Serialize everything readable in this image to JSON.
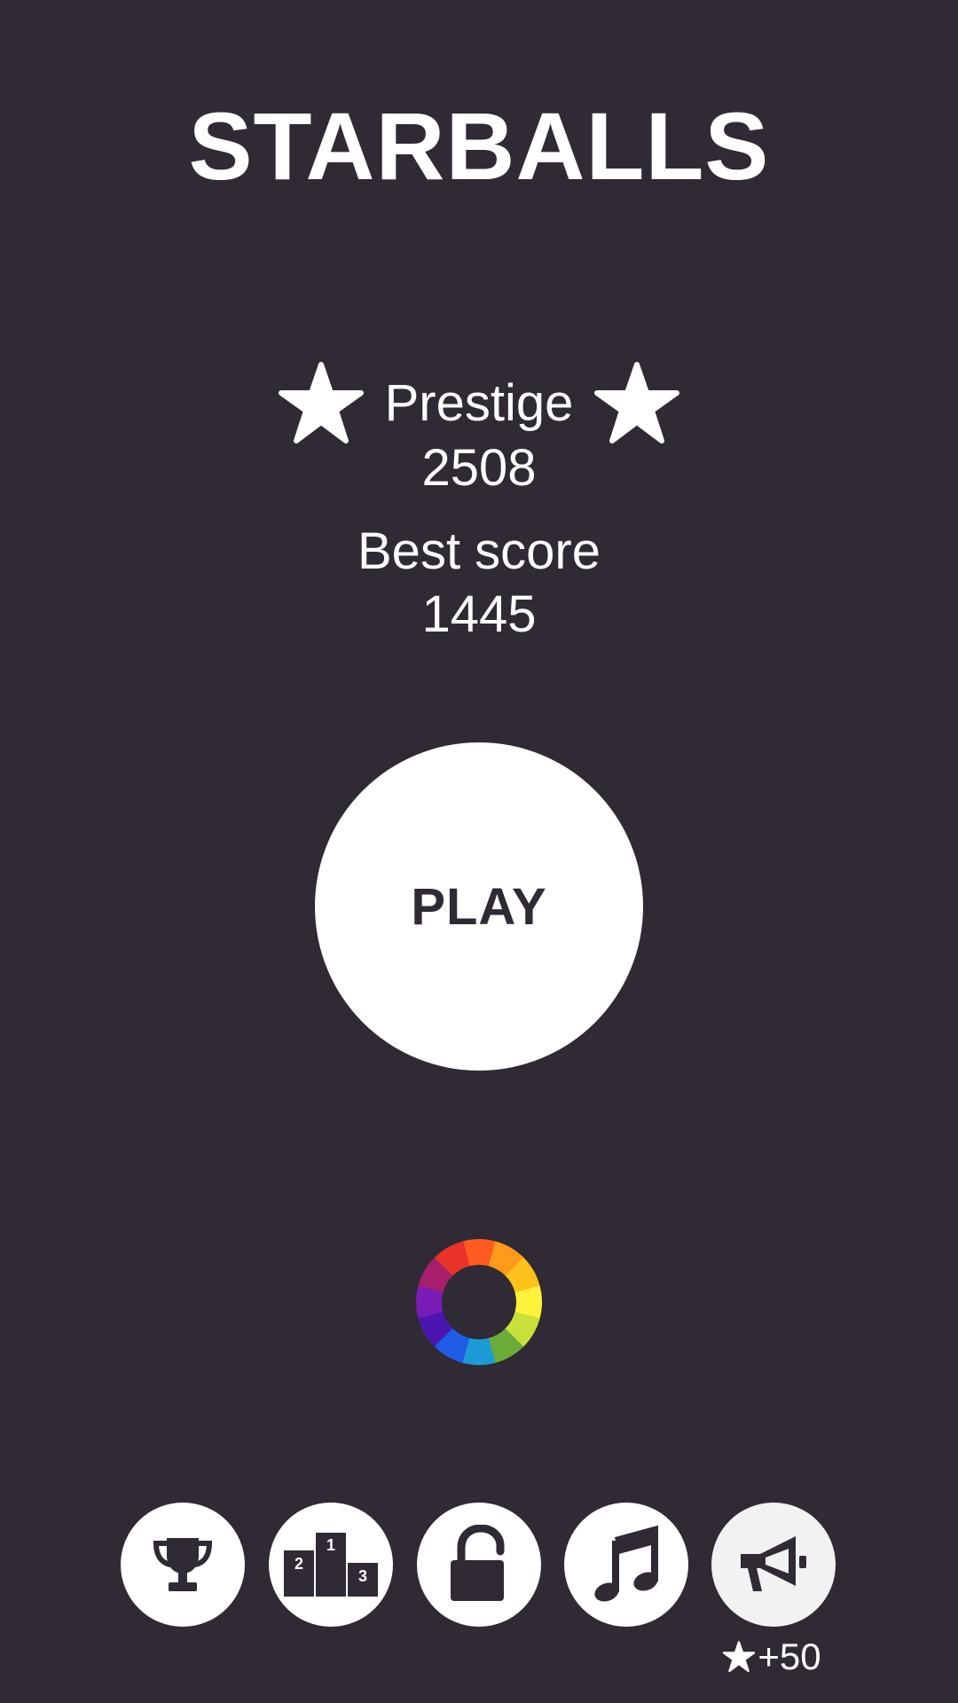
{
  "app": {
    "title": "STARBALLS"
  },
  "stats": {
    "prestige_label": "Prestige",
    "prestige_value": "2508",
    "best_score_label": "Best score",
    "best_score_value": "1445"
  },
  "play_button": {
    "label": "PLAY"
  },
  "color_wheel": {
    "colors": [
      "#ff5a1f",
      "#ff9a1a",
      "#ffc21a",
      "#fff23a",
      "#c8e03a",
      "#6aab3a",
      "#1c9bd6",
      "#1f5ce6",
      "#4b16b0",
      "#7a1bb8",
      "#a51f6a",
      "#e8322a"
    ]
  },
  "toolbar": {
    "buttons": [
      {
        "icon": "trophy-icon"
      },
      {
        "icon": "podium-icon",
        "places": [
          "1",
          "2",
          "3"
        ]
      },
      {
        "icon": "unlock-icon"
      },
      {
        "icon": "music-note-icon"
      },
      {
        "icon": "megaphone-icon"
      }
    ],
    "reward_text": "+50"
  },
  "colors": {
    "background": "#2f2a33",
    "foreground": "#ffffff"
  }
}
